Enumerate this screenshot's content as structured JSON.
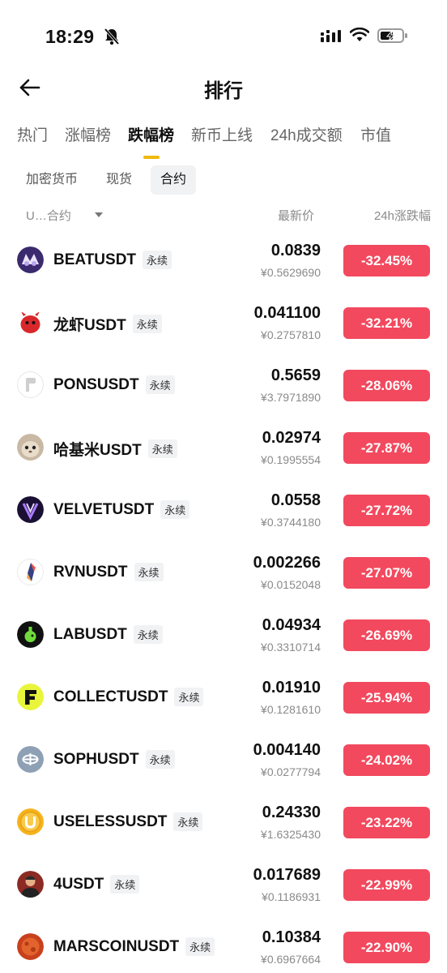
{
  "status_bar": {
    "time": "18:29"
  },
  "header": {
    "title": "排行"
  },
  "main_tabs": [
    "热门",
    "涨幅榜",
    "跌幅榜",
    "新币上线",
    "24h成交额",
    "市值"
  ],
  "sub_tabs": [
    "加密货币",
    "现货",
    "合约"
  ],
  "columns": {
    "name": "U…合约",
    "price": "最新价",
    "change": "24h涨跌幅"
  },
  "colors": {
    "accent": "#f0b90b",
    "down": "#f2495e"
  },
  "rows": [
    {
      "symbol": "BEATUSDT",
      "tag": "永续",
      "price": "0.0839",
      "cny": "¥0.5629690",
      "change": "-32.45%",
      "icon": "beat-icon"
    },
    {
      "symbol": "龙虾USDT",
      "tag": "永续",
      "price": "0.041100",
      "cny": "¥0.2757810",
      "change": "-32.21%",
      "icon": "lobster-icon"
    },
    {
      "symbol": "PONSUSDT",
      "tag": "永续",
      "price": "0.5659",
      "cny": "¥3.7971890",
      "change": "-28.06%",
      "icon": "pons-icon"
    },
    {
      "symbol": "哈基米USDT",
      "tag": "永续",
      "price": "0.02974",
      "cny": "¥0.1995554",
      "change": "-27.87%",
      "icon": "hachimi-icon"
    },
    {
      "symbol": "VELVETUSDT",
      "tag": "永续",
      "price": "0.0558",
      "cny": "¥0.3744180",
      "change": "-27.72%",
      "icon": "velvet-icon"
    },
    {
      "symbol": "RVNUSDT",
      "tag": "永续",
      "price": "0.002266",
      "cny": "¥0.0152048",
      "change": "-27.07%",
      "icon": "rvn-icon"
    },
    {
      "symbol": "LABUSDT",
      "tag": "永续",
      "price": "0.04934",
      "cny": "¥0.3310714",
      "change": "-26.69%",
      "icon": "lab-icon"
    },
    {
      "symbol": "COLLECTUSDT",
      "tag": "永续",
      "price": "0.01910",
      "cny": "¥0.1281610",
      "change": "-25.94%",
      "icon": "collect-icon"
    },
    {
      "symbol": "SOPHUSDT",
      "tag": "永续",
      "price": "0.004140",
      "cny": "¥0.0277794",
      "change": "-24.02%",
      "icon": "soph-icon"
    },
    {
      "symbol": "USELESSUSDT",
      "tag": "永续",
      "price": "0.24330",
      "cny": "¥1.6325430",
      "change": "-23.22%",
      "icon": "useless-icon"
    },
    {
      "symbol": "4USDT",
      "tag": "永续",
      "price": "0.017689",
      "cny": "¥0.1186931",
      "change": "-22.99%",
      "icon": "four-icon"
    },
    {
      "symbol": "MARSCOINUSDT",
      "tag": "永续",
      "price": "0.10384",
      "cny": "¥0.6967664",
      "change": "-22.90%",
      "icon": "marscoin-icon"
    }
  ]
}
